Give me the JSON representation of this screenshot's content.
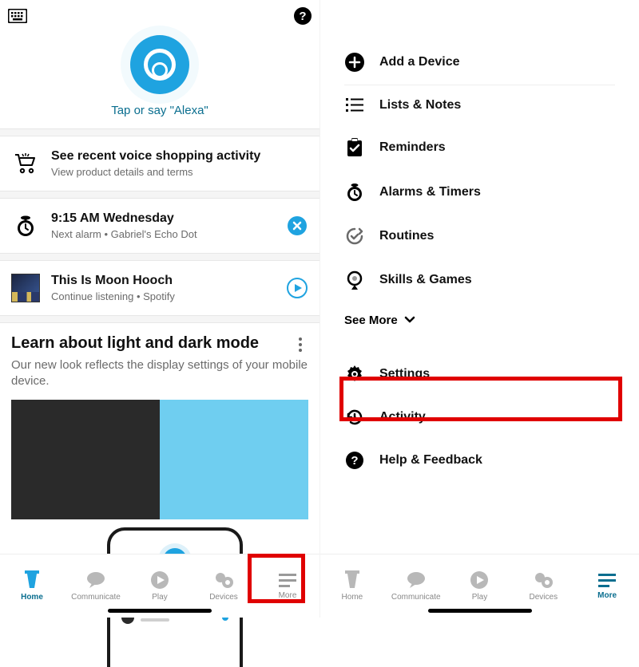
{
  "left": {
    "alexa_tap": "Tap or say \"Alexa\"",
    "shopping": {
      "title": "See recent voice shopping activity",
      "sub": "View product details and terms"
    },
    "alarm": {
      "title": "9:15 AM Wednesday",
      "sub": "Next alarm • Gabriel's Echo Dot"
    },
    "music": {
      "title": "This Is Moon Hooch",
      "sub": "Continue listening • Spotify"
    },
    "learn": {
      "title": "Learn about light and dark mode",
      "sub": "Our new look reflects the display settings of your mobile device."
    },
    "tabs": [
      {
        "label": "Home"
      },
      {
        "label": "Communicate"
      },
      {
        "label": "Play"
      },
      {
        "label": "Devices"
      },
      {
        "label": "More"
      }
    ]
  },
  "right": {
    "items": [
      {
        "label": "Add a Device"
      },
      {
        "label": "Lists & Notes"
      },
      {
        "label": "Reminders"
      },
      {
        "label": "Alarms & Timers"
      },
      {
        "label": "Routines"
      },
      {
        "label": "Skills & Games"
      }
    ],
    "see_more": "See More",
    "items2": [
      {
        "label": "Settings"
      },
      {
        "label": "Activity"
      },
      {
        "label": "Help & Feedback"
      }
    ],
    "tabs": [
      {
        "label": "Home"
      },
      {
        "label": "Communicate"
      },
      {
        "label": "Play"
      },
      {
        "label": "Devices"
      },
      {
        "label": "More"
      }
    ]
  }
}
